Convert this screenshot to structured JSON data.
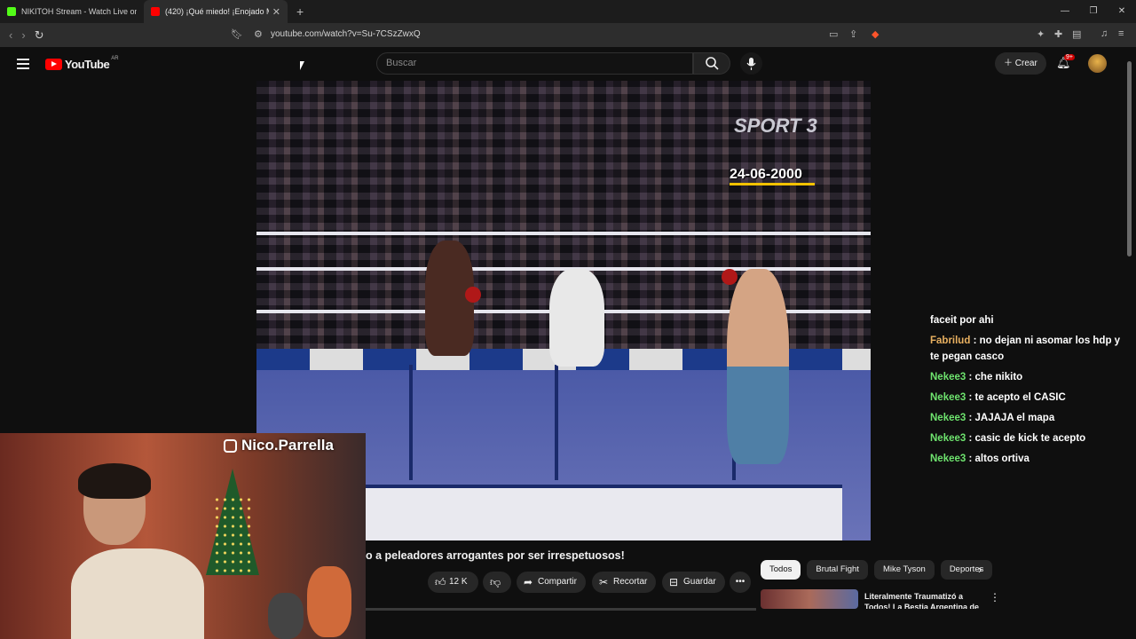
{
  "browser": {
    "tabs": [
      {
        "label": "NIKITOH Stream - Watch Live on Kick",
        "color": "#53fc18"
      },
      {
        "label": "(420) ¡Qué miedo! ¡Enojado M",
        "color": "#ff0000"
      }
    ],
    "new_tab": "+",
    "url": "youtube.com/watch?v=Su-7CSzZwxQ"
  },
  "youtube": {
    "logo_text": "YouTube",
    "region": "AR",
    "search_placeholder": "Buscar",
    "create_label": "Crear",
    "notifications": "9+"
  },
  "video": {
    "channel_logo": "SPORT 3",
    "date_overlay": "24-06-2000",
    "title": "o a peleadores arrogantes por ser irrespetuosos!"
  },
  "webcam": {
    "handle": "Nico.Parrella"
  },
  "chat": {
    "messages": [
      {
        "user": "",
        "text": "faceit por ahi"
      },
      {
        "user": "Fabrilud",
        "text": ": no dejan ni asomar los hdp y te pegan casco"
      },
      {
        "user": "Nekee3",
        "text": ": che nikito"
      },
      {
        "user": "Nekee3",
        "text": ": te acepto el CASIC"
      },
      {
        "user": "Nekee3",
        "text": ": JAJAJA el mapa"
      },
      {
        "user": "Nekee3",
        "text": ": casic de kick te acepto"
      },
      {
        "user": "Nekee3",
        "text": ": altos ortiva"
      }
    ]
  },
  "actions": {
    "likes": "12 K",
    "share": "Compartir",
    "clip": "Recortar",
    "save": "Guardar"
  },
  "chips": [
    "Todos",
    "Brutal Fight",
    "Mike Tyson",
    "Deportes"
  ],
  "recommendation": {
    "title": "Literalmente Traumatizó a Todos! La Bestia Argentina de"
  }
}
